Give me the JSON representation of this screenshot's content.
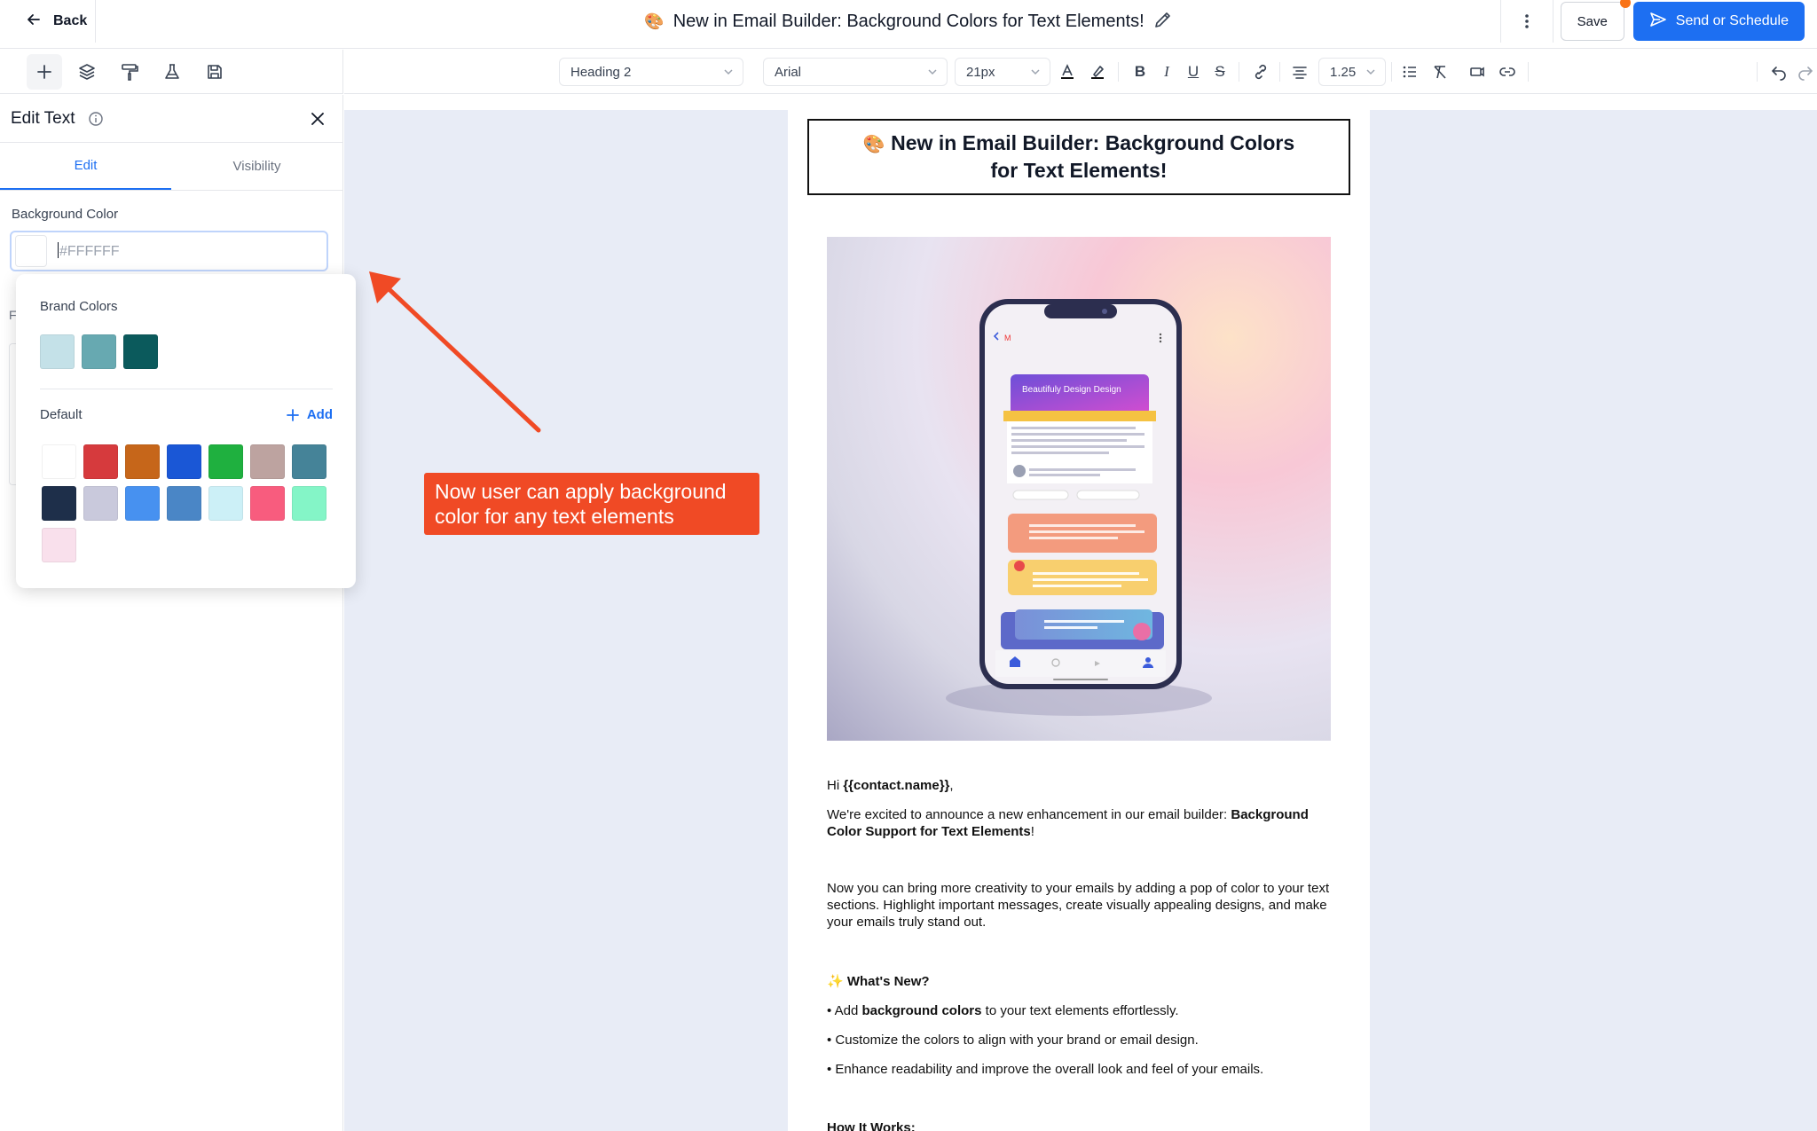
{
  "topbar": {
    "back_label": "Back",
    "title_emoji": "🎨",
    "title": "New in Email Builder: Background Colors for Text Elements!",
    "save_label": "Save",
    "send_label": "Send or Schedule"
  },
  "toolbar": {
    "block_type": "Heading 2",
    "font_family": "Arial",
    "font_size": "21px",
    "bold": "B",
    "italic": "I",
    "underline": "U",
    "strike": "S",
    "line_height": "1.25"
  },
  "panel": {
    "title": "Edit Text",
    "tabs": [
      "Edit",
      "Visibility"
    ],
    "background_color_label": "Background Color",
    "background_color_value": "#FFFFFF",
    "hidden_field_initial": "F"
  },
  "color_picker": {
    "brand_label": "Brand Colors",
    "brand_colors": [
      "#c4e1e8",
      "#67a9b1",
      "#0b5a5c"
    ],
    "default_label": "Default",
    "add_label": "Add",
    "default_colors": [
      "#ffffff",
      "#d63a3d",
      "#c6661a",
      "#1a57d6",
      "#1fb03f",
      "#bda3a0",
      "#458398",
      "#1e2f4a",
      "#c9c9dc",
      "#4791f0",
      "#4a86c6",
      "#ccf0f7",
      "#f85c7e",
      "#84f5c7",
      "#f9e0ec"
    ]
  },
  "annotation": {
    "callout_text": "Now user can apply background color for any text elements",
    "color": "#f04a25"
  },
  "email": {
    "heading_emoji": "🎨",
    "heading": "New in Email Builder: Background Colors for Text Elements!",
    "phone": {
      "card_title": "Beautifuly Design Design"
    },
    "greeting_prefix": "Hi ",
    "greeting_name": "{{contact.name}}",
    "greeting_suffix": ",",
    "intro_text": "We're excited to announce a new enhancement in our email builder: ",
    "intro_bold": "Background Color Support for Text Elements",
    "intro_end": "!",
    "para2": "Now you can bring more creativity to your emails by adding a pop of color to your text sections. Highlight important messages, create visually appealing designs, and make your emails truly stand out.",
    "whats_new_emoji": "✨",
    "whats_new": "What's New?",
    "bullet1_pre": "• Add ",
    "bullet1_bold": "background colors",
    "bullet1_post": " to your text elements effortlessly.",
    "bullet2": "• Customize the colors to align with your brand or email design.",
    "bullet3": "• Enhance readability and improve the overall look and feel of your emails.",
    "how_it_works": "How It Works:"
  },
  "colors": {
    "accent": "#1d6ff2",
    "canvas_bg": "#e8ecf6",
    "notification_dot": "#f97316"
  }
}
